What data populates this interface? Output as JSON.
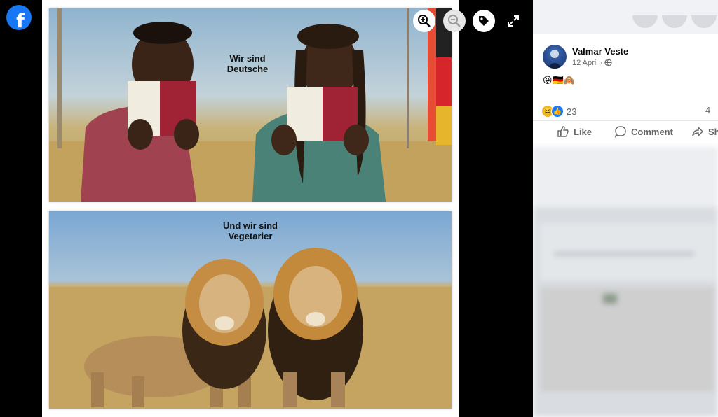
{
  "brand": {
    "logo_letter": "f",
    "color": "#1877f2"
  },
  "photo": {
    "top_caption_line1": "Wir sind",
    "top_caption_line2": "Deutsche",
    "bottom_caption_line1": "Und wir sind",
    "bottom_caption_line2": "Vegetarier"
  },
  "viewer_controls": {
    "zoom_in": "zoom-in-icon",
    "zoom_out": "zoom-out-icon",
    "tag": "tag-icon",
    "fullscreen": "fullscreen-icon"
  },
  "post": {
    "author": "Valmar Veste",
    "date": "12 April · ",
    "privacy_icon": "globe-icon",
    "text_emoji": "😜🇩🇪🙈",
    "reaction_count": "23",
    "comment_count": "4",
    "actions": {
      "like": "Like",
      "comment": "Comment",
      "share": "Sh"
    }
  }
}
